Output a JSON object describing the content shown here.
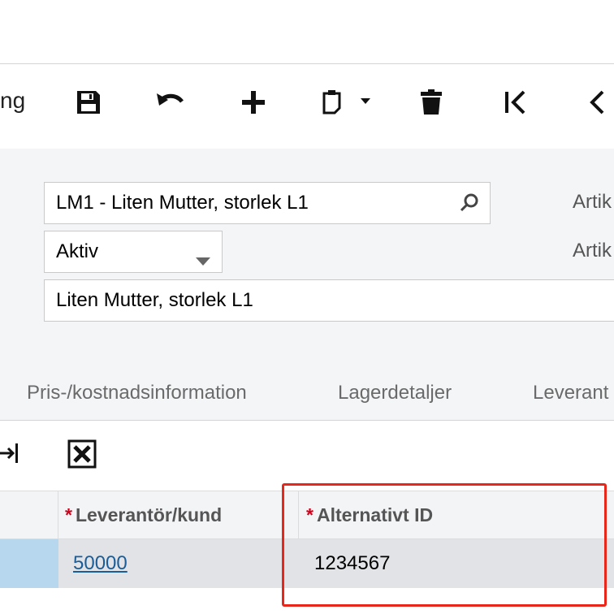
{
  "toolbar": {
    "partial_label": "ng",
    "icons": [
      "save-icon",
      "undo-icon",
      "add-icon",
      "copy-paste-icon",
      "delete-icon",
      "first-record-icon",
      "previous-record-icon"
    ]
  },
  "form": {
    "item_lookup_value": "LM1 - Liten Mutter, storlek L1",
    "status_value": "Aktiv",
    "description_value": "Liten Mutter, storlek L1",
    "side_label_1": "Artik",
    "side_label_2": "Artik"
  },
  "tabs": [
    "Pris-/kostnadsinformation",
    "Lagerdetaljer",
    "Leverant"
  ],
  "grid": {
    "required_marker": "*",
    "columns": [
      "Leverantör/kund",
      "Alternativt ID"
    ],
    "rows": [
      {
        "vendor": "50000",
        "alternate_id": "1234567"
      }
    ]
  },
  "colors": {
    "accent_link": "#1a5d99",
    "required": "#d0021b",
    "highlight_box": "#e8261a",
    "row_selected": "#b7d7ee"
  }
}
